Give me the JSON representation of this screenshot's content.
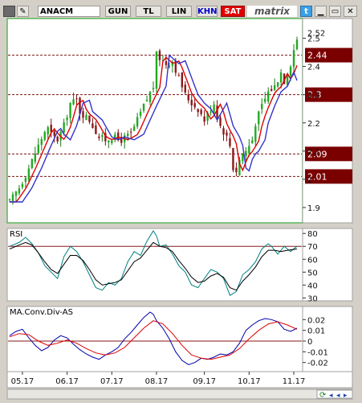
{
  "toolbar": {
    "symbol": "ANACM",
    "periods": [
      "GUN",
      "TL",
      "LIN",
      "KHN",
      "SAT"
    ],
    "brand": "matrix",
    "active_color": "#e00000",
    "khn_color": "#0000cc"
  },
  "chart_data": [
    {
      "type": "candlestick",
      "panel": "price",
      "ylim": [
        1.86,
        2.55
      ],
      "y_ticks": [
        1.9,
        2.0,
        2.1,
        2.2,
        2.3,
        2.4,
        2.5
      ],
      "y_tick_labels": [
        "1.9",
        "2",
        "2.1",
        "2.2",
        "2.3",
        "2.4",
        "2.5"
      ],
      "current_price_label": "2.52",
      "levels": [
        {
          "value": 2.44,
          "label": "2.44"
        },
        {
          "value": 2.3,
          "label": "2.3"
        },
        {
          "value": 2.09,
          "label": "2.09"
        },
        {
          "value": 2.01,
          "label": "2.01"
        }
      ],
      "moving_averages": [
        {
          "color": "#dd0000"
        },
        {
          "color": "#3333cc"
        }
      ],
      "close_path": [
        [
          0,
          1.92
        ],
        [
          3,
          1.97
        ],
        [
          6,
          2.04
        ],
        [
          9,
          2.12
        ],
        [
          11,
          2.17
        ],
        [
          12,
          2.18
        ],
        [
          13,
          2.16
        ],
        [
          15,
          2.14
        ],
        [
          17,
          2.19
        ],
        [
          19,
          2.27
        ],
        [
          21,
          2.28
        ],
        [
          22,
          2.24
        ],
        [
          25,
          2.21
        ],
        [
          28,
          2.15
        ],
        [
          30,
          2.14
        ],
        [
          32,
          2.15
        ],
        [
          35,
          2.14
        ],
        [
          38,
          2.16
        ],
        [
          40,
          2.21
        ],
        [
          42,
          2.26
        ],
        [
          45,
          2.33
        ],
        [
          46,
          2.44
        ],
        [
          47,
          2.43
        ],
        [
          49,
          2.41
        ],
        [
          51,
          2.42
        ],
        [
          53,
          2.36
        ],
        [
          55,
          2.3
        ],
        [
          57,
          2.27
        ],
        [
          59,
          2.25
        ],
        [
          61,
          2.21
        ],
        [
          63,
          2.25
        ],
        [
          64,
          2.27
        ],
        [
          66,
          2.19
        ],
        [
          68,
          2.15
        ],
        [
          69,
          2.12
        ],
        [
          70,
          2.04
        ],
        [
          71,
          2.03
        ],
        [
          72,
          2.07
        ],
        [
          73,
          2.09
        ],
        [
          74,
          2.1
        ],
        [
          76,
          2.14
        ],
        [
          77,
          2.2
        ],
        [
          79,
          2.26
        ],
        [
          81,
          2.31
        ],
        [
          83,
          2.33
        ],
        [
          85,
          2.38
        ],
        [
          86,
          2.35
        ],
        [
          88,
          2.41
        ],
        [
          89,
          2.46
        ],
        [
          90,
          2.5
        ]
      ]
    },
    {
      "type": "line",
      "panel": "indicator",
      "title": "RSI",
      "ylim": [
        29,
        82
      ],
      "y_ticks": [
        30,
        40,
        50,
        60,
        70,
        80
      ],
      "y_tick_labels": [
        "30",
        "40",
        "50",
        "60",
        "70",
        "80"
      ],
      "reference_level": 70,
      "series": [
        {
          "color": "#008080",
          "values": [
            [
              0,
              70
            ],
            [
              3,
              73
            ],
            [
              5,
              77
            ],
            [
              7,
              72
            ],
            [
              9,
              65
            ],
            [
              11,
              55
            ],
            [
              13,
              50
            ],
            [
              15,
              45
            ],
            [
              17,
              62
            ],
            [
              19,
              70
            ],
            [
              21,
              66
            ],
            [
              23,
              58
            ],
            [
              25,
              48
            ],
            [
              27,
              38
            ],
            [
              29,
              36
            ],
            [
              31,
              42
            ],
            [
              33,
              40
            ],
            [
              35,
              45
            ],
            [
              37,
              58
            ],
            [
              39,
              66
            ],
            [
              41,
              63
            ],
            [
              43,
              74
            ],
            [
              45,
              82
            ],
            [
              46,
              78
            ],
            [
              47,
              70
            ],
            [
              49,
              71
            ],
            [
              51,
              64
            ],
            [
              53,
              55
            ],
            [
              55,
              50
            ],
            [
              57,
              40
            ],
            [
              59,
              38
            ],
            [
              61,
              45
            ],
            [
              63,
              52
            ],
            [
              65,
              50
            ],
            [
              67,
              45
            ],
            [
              69,
              32
            ],
            [
              71,
              35
            ],
            [
              73,
              48
            ],
            [
              75,
              52
            ],
            [
              77,
              58
            ],
            [
              79,
              68
            ],
            [
              81,
              72
            ],
            [
              82,
              70
            ],
            [
              84,
              64
            ],
            [
              86,
              70
            ],
            [
              88,
              66
            ],
            [
              90,
              70
            ]
          ]
        },
        {
          "color": "#000000",
          "values": [
            [
              0,
              68
            ],
            [
              3,
              71
            ],
            [
              5,
              73
            ],
            [
              7,
              71
            ],
            [
              9,
              65
            ],
            [
              11,
              58
            ],
            [
              13,
              52
            ],
            [
              15,
              49
            ],
            [
              17,
              56
            ],
            [
              19,
              63
            ],
            [
              21,
              63
            ],
            [
              23,
              59
            ],
            [
              25,
              52
            ],
            [
              27,
              44
            ],
            [
              29,
              40
            ],
            [
              31,
              41
            ],
            [
              33,
              42
            ],
            [
              35,
              44
            ],
            [
              37,
              51
            ],
            [
              39,
              58
            ],
            [
              41,
              61
            ],
            [
              43,
              67
            ],
            [
              45,
              73
            ],
            [
              47,
              70
            ],
            [
              49,
              69
            ],
            [
              51,
              66
            ],
            [
              53,
              59
            ],
            [
              55,
              53
            ],
            [
              57,
              46
            ],
            [
              59,
              42
            ],
            [
              61,
              43
            ],
            [
              63,
              47
            ],
            [
              65,
              49
            ],
            [
              67,
              46
            ],
            [
              69,
              38
            ],
            [
              71,
              36
            ],
            [
              73,
              43
            ],
            [
              75,
              48
            ],
            [
              77,
              54
            ],
            [
              79,
              62
            ],
            [
              81,
              67
            ],
            [
              83,
              67
            ],
            [
              85,
              66
            ],
            [
              87,
              67
            ],
            [
              90,
              68
            ]
          ]
        }
      ]
    },
    {
      "type": "line",
      "panel": "indicator",
      "title": "MA.Conv.Div-AS",
      "ylim": [
        -0.027,
        0.03
      ],
      "y_ticks": [
        -0.02,
        -0.01,
        0,
        0.01,
        0.02
      ],
      "y_tick_labels": [
        "-0.02",
        "-0.01",
        "0",
        "0.01",
        "0.02"
      ],
      "reference_level": 0,
      "series": [
        {
          "color": "#0000aa",
          "values": [
            [
              0,
              0.005
            ],
            [
              2,
              0.009
            ],
            [
              4,
              0.011
            ],
            [
              6,
              0.003
            ],
            [
              8,
              -0.004
            ],
            [
              10,
              -0.009
            ],
            [
              12,
              -0.006
            ],
            [
              14,
              0.001
            ],
            [
              16,
              0.005
            ],
            [
              18,
              0.003
            ],
            [
              20,
              -0.003
            ],
            [
              22,
              -0.008
            ],
            [
              24,
              -0.012
            ],
            [
              26,
              -0.015
            ],
            [
              28,
              -0.017
            ],
            [
              30,
              -0.013
            ],
            [
              32,
              -0.01
            ],
            [
              34,
              -0.006
            ],
            [
              36,
              0.002
            ],
            [
              38,
              0.008
            ],
            [
              40,
              0.015
            ],
            [
              42,
              0.022
            ],
            [
              44,
              0.027
            ],
            [
              45,
              0.025
            ],
            [
              46,
              0.019
            ],
            [
              48,
              0.012
            ],
            [
              50,
              0.002
            ],
            [
              52,
              -0.01
            ],
            [
              54,
              -0.018
            ],
            [
              56,
              -0.022
            ],
            [
              58,
              -0.02
            ],
            [
              60,
              -0.016
            ],
            [
              62,
              -0.017
            ],
            [
              64,
              -0.015
            ],
            [
              66,
              -0.012
            ],
            [
              68,
              -0.013
            ],
            [
              70,
              -0.01
            ],
            [
              72,
              -0.002
            ],
            [
              74,
              0.01
            ],
            [
              76,
              0.015
            ],
            [
              78,
              0.019
            ],
            [
              80,
              0.021
            ],
            [
              82,
              0.02
            ],
            [
              84,
              0.018
            ],
            [
              86,
              0.011
            ],
            [
              88,
              0.009
            ],
            [
              90,
              0.012
            ]
          ]
        },
        {
          "color": "#dd0000",
          "values": [
            [
              0,
              0.004
            ],
            [
              3,
              0.007
            ],
            [
              6,
              0.006
            ],
            [
              9,
              0.0
            ],
            [
              12,
              -0.004
            ],
            [
              15,
              -0.002
            ],
            [
              18,
              0.001
            ],
            [
              21,
              -0.002
            ],
            [
              24,
              -0.007
            ],
            [
              27,
              -0.011
            ],
            [
              30,
              -0.013
            ],
            [
              33,
              -0.011
            ],
            [
              36,
              -0.006
            ],
            [
              39,
              0.003
            ],
            [
              42,
              0.012
            ],
            [
              45,
              0.019
            ],
            [
              48,
              0.016
            ],
            [
              51,
              0.007
            ],
            [
              54,
              -0.004
            ],
            [
              57,
              -0.013
            ],
            [
              60,
              -0.016
            ],
            [
              63,
              -0.017
            ],
            [
              66,
              -0.015
            ],
            [
              69,
              -0.013
            ],
            [
              72,
              -0.007
            ],
            [
              75,
              0.002
            ],
            [
              78,
              0.01
            ],
            [
              81,
              0.016
            ],
            [
              84,
              0.018
            ],
            [
              87,
              0.015
            ],
            [
              90,
              0.011
            ]
          ]
        }
      ]
    }
  ],
  "x_axis": {
    "tick_labels": [
      "05.17",
      "06.17",
      "07.17",
      "08.17",
      "09.17",
      "10.17",
      "11.17"
    ],
    "tick_index": [
      4,
      18,
      32,
      46,
      61,
      75,
      89
    ]
  }
}
